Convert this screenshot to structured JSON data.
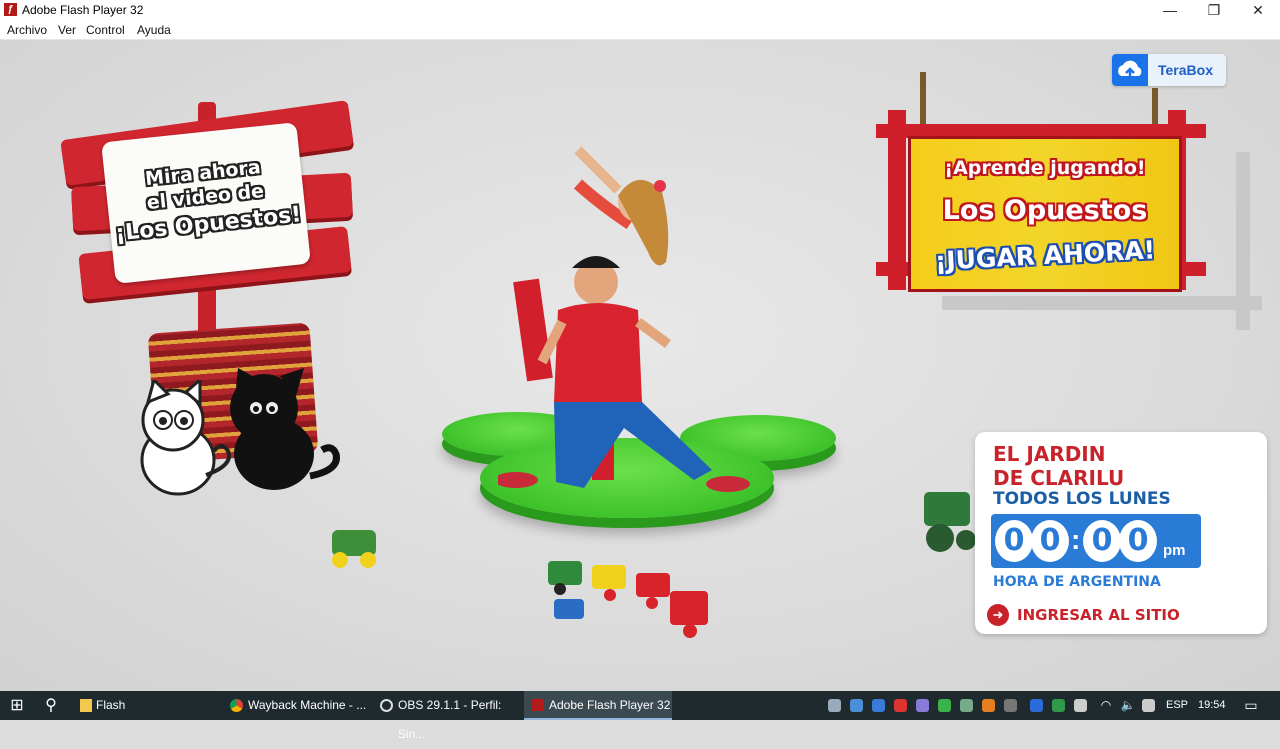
{
  "window": {
    "title": "Adobe Flash Player 32",
    "minimize": "—",
    "restore": "❐",
    "close": "✕"
  },
  "menu": [
    "Archivo",
    "Ver",
    "Control",
    "Ayuda"
  ],
  "left_sign": {
    "line1": "Mira ahora",
    "line2": "el video de",
    "line3": "¡Los Opuestos!"
  },
  "right_sign": {
    "line1": "¡Aprende jugando!",
    "line2": "Los Opuestos",
    "line3": "¡JUGAR AHORA!"
  },
  "terabox": {
    "label": "TeraBox"
  },
  "panel": {
    "line1": "EL JARDIN",
    "line2": "DE CLARILU",
    "schedule": "TODOS LOS LUNES",
    "time": {
      "h1": "0",
      "h2": "0",
      "m1": "0",
      "m2": "0",
      "ampm": "pm"
    },
    "zone": "HORA DE ARGENTINA",
    "link": "INGRESAR AL SITIO"
  },
  "taskbar": {
    "items": [
      "Flash",
      "Wayback Machine - ...",
      "OBS 29.1.1 - Perfil: Sin...",
      "Adobe Flash Player 32"
    ],
    "lang": "ESP",
    "clock": "19:54"
  },
  "colors": {
    "brand_red": "#c8232b",
    "brand_blue": "#2a7bd6",
    "platform_green": "#3ec22a",
    "sign_yellow": "#f5cd1c"
  }
}
